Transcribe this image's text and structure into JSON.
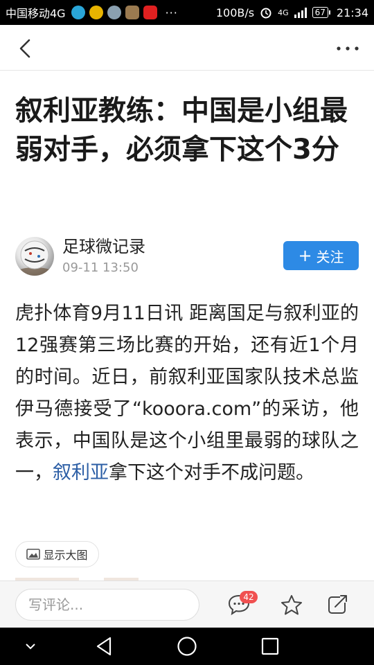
{
  "status_bar": {
    "carrier": "中国移动4G",
    "app_icons": [
      {
        "icon": "moon-app-icon",
        "color": "#2aa6d8"
      },
      {
        "icon": "ball-app-icon",
        "color": "#e8b400"
      },
      {
        "icon": "avatar-app-icon",
        "color": "#8aa0b0"
      },
      {
        "icon": "bag-app-icon",
        "color": "#9a7a50"
      },
      {
        "icon": "toutiao-app-icon",
        "color": "#e02020"
      }
    ],
    "more": "···",
    "net_speed": "100B/s",
    "network": "4G",
    "battery": "67",
    "time": "21:34"
  },
  "topnav": {
    "back_icon": "chevron-left-icon",
    "more_icon": "more-horizontal-icon"
  },
  "article": {
    "title": "叙利亚教练：中国是小组最弱对手，必须拿下这个3分",
    "author": {
      "name": "足球微记录",
      "time": "09-11 13:50",
      "avatar_icon": "football-avatar"
    },
    "follow_button": {
      "plus": "+",
      "label": "关注"
    },
    "body_before_link": "虎扑体育9月11日讯 距离国足与叙利亚的12强赛第三场比赛的开始，还有近1个月的时间。近日，前叙利亚国家队技术总监伊马德接受了“kooora.com”的采访，他表示，中国队是这个小组里最弱的球队之一，",
    "body_link": "叙利亚",
    "body_after_link": "拿下这个对手不成问题。",
    "show_image_button": "显示大图"
  },
  "action_bar": {
    "comment_placeholder": "写评论...",
    "comment_count": "42",
    "comment_icon": "comment-icon",
    "favorite_icon": "star-icon",
    "share_icon": "share-icon"
  },
  "system_nav": {
    "down_icon": "chevron-down-icon",
    "back_icon": "triangle-back-icon",
    "home_icon": "circle-home-icon",
    "recents_icon": "square-recents-icon"
  },
  "colors": {
    "accent": "#2d8ae5",
    "link": "#2d5fa6",
    "badge": "#f05050"
  }
}
